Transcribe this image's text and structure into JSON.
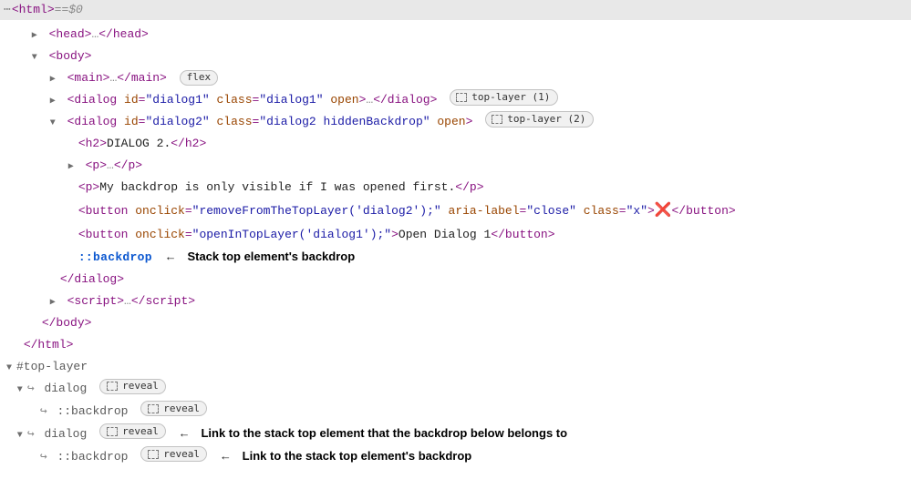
{
  "topbar": {
    "dots": "⋯",
    "htmlOpen": "<html>",
    "eq": " == ",
    "var": "$0"
  },
  "tree": {
    "headOpen": "<head>",
    "ell": "…",
    "headClose": "</head>",
    "bodyOpen": "<body>",
    "mainOpen": "<main>",
    "mainClose": "</main>",
    "flexBadge": "flex",
    "d1_open1": "<dialog ",
    "d1_idk": "id",
    "d1_idv": "\"dialog1\"",
    "d1_classk": "class",
    "d1_classv": "\"dialog1\"",
    "d1_openk": "open",
    "d1_close": "</dialog>",
    "topLayerBadge1": "top-layer (1)",
    "d2_idv": "\"dialog2\"",
    "d2_classv": "\"dialog2 hiddenBackdrop\"",
    "topLayerBadge2": "top-layer (2)",
    "h2Open": "<h2>",
    "h2Text": "DIALOG 2.",
    "h2Close": "</h2>",
    "pOpen": "<p>",
    "pClose": "</p>",
    "pText": "My backdrop is only visible if I was opened first.",
    "btn1_onclickv": "\"removeFromTheTopLayer('dialog2');\"",
    "btn1_ariak": "aria-label",
    "btn1_ariav": "\"close\"",
    "btn1_classv": "\"x\"",
    "btn1_x": "❌",
    "btnOpen": "<button ",
    "btnClose": "</button>",
    "onclickk": "onclick",
    "btn2_onclickv": "\"openInTopLayer('dialog1');\"",
    "btn2_text": "Open Dialog 1",
    "backdrop": "::backdrop",
    "annot_backdrop": "Stack top element's backdrop",
    "dialogClose": "</dialog>",
    "scriptOpen": "<script>",
    "scriptClose": "</script>",
    "bodyClose": "</body>",
    "htmlClose": "</html>"
  },
  "topLayer": {
    "header": "#top-layer",
    "dialog": "dialog",
    "reveal": "reveal",
    "backdrop": "::backdrop",
    "annot_link_elem": "Link to the stack top element that the backdrop below belongs to",
    "annot_link_backdrop": "Link to the stack top element's backdrop"
  },
  "glyph": {
    "arrow_left": "←",
    "hook": "↪"
  }
}
